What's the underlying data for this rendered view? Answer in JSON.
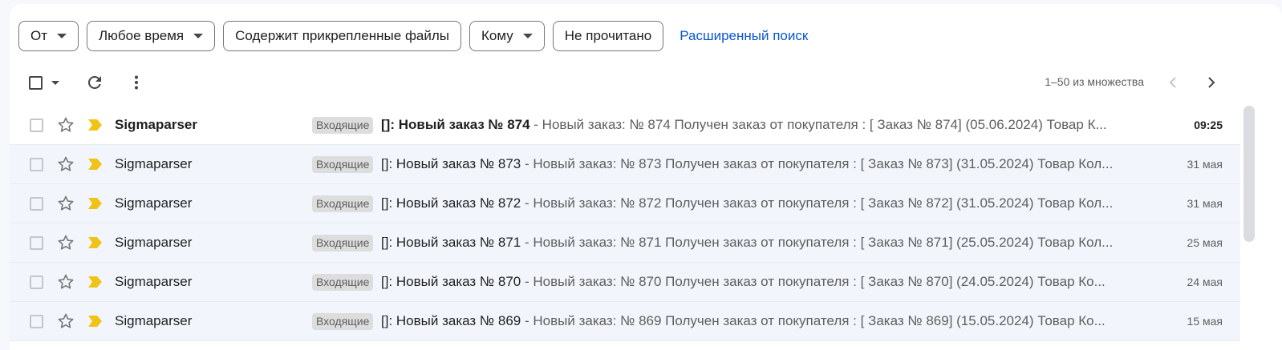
{
  "filters": {
    "from_label": "От",
    "time_label": "Любое время",
    "attachments_label": "Содержит прикрепленные файлы",
    "to_label": "Кому",
    "unread_label": "Не прочитано",
    "advanced_label": "Расширенный поиск"
  },
  "toolbar": {
    "count_text": "1–50 из множества"
  },
  "icons": {
    "select": "checkbox-icon",
    "select_menu": "caret-down-icon",
    "refresh": "refresh-icon",
    "more": "more-vert-icon",
    "prev": "chevron-left-icon",
    "next": "chevron-right-icon",
    "star": "star-outline-icon",
    "importance": "important-marker-icon"
  },
  "colors": {
    "accent": "#0b57d0",
    "importance": "#f2c317",
    "label_bg": "#dddddd"
  },
  "emails": [
    {
      "sender": "Sigmaparser",
      "label": "Входящие",
      "subject": "[]: Новый заказ № 874",
      "preview": " - Новый заказ: № 874 Получен заказ от покупателя : [ Заказ № 874] (05.06.2024) Товар К...",
      "date": "09:25",
      "unread": true
    },
    {
      "sender": "Sigmaparser",
      "label": "Входящие",
      "subject": "[]: Новый заказ № 873",
      "preview": " - Новый заказ: № 873 Получен заказ от покупателя : [ Заказ № 873] (31.05.2024) Товар Кол...",
      "date": "31 мая",
      "unread": false
    },
    {
      "sender": "Sigmaparser",
      "label": "Входящие",
      "subject": "[]: Новый заказ № 872",
      "preview": " - Новый заказ: № 872 Получен заказ от покупателя : [ Заказ № 872] (31.05.2024) Товар Кол...",
      "date": "31 мая",
      "unread": false
    },
    {
      "sender": "Sigmaparser",
      "label": "Входящие",
      "subject": "[]: Новый заказ № 871",
      "preview": " - Новый заказ: № 871 Получен заказ от покупателя : [ Заказ № 871] (25.05.2024) Товар Кол...",
      "date": "25 мая",
      "unread": false
    },
    {
      "sender": "Sigmaparser",
      "label": "Входящие",
      "subject": "[]: Новый заказ № 870",
      "preview": " - Новый заказ: № 870 Получен заказ от покупателя : [ Заказ № 870] (24.05.2024) Товар Ко...",
      "date": "24 мая",
      "unread": false
    },
    {
      "sender": "Sigmaparser",
      "label": "Входящие",
      "subject": "[]: Новый заказ № 869",
      "preview": " - Новый заказ: № 869 Получен заказ от покупателя : [ Заказ № 869] (15.05.2024) Товар Ко...",
      "date": "15 мая",
      "unread": false
    }
  ]
}
